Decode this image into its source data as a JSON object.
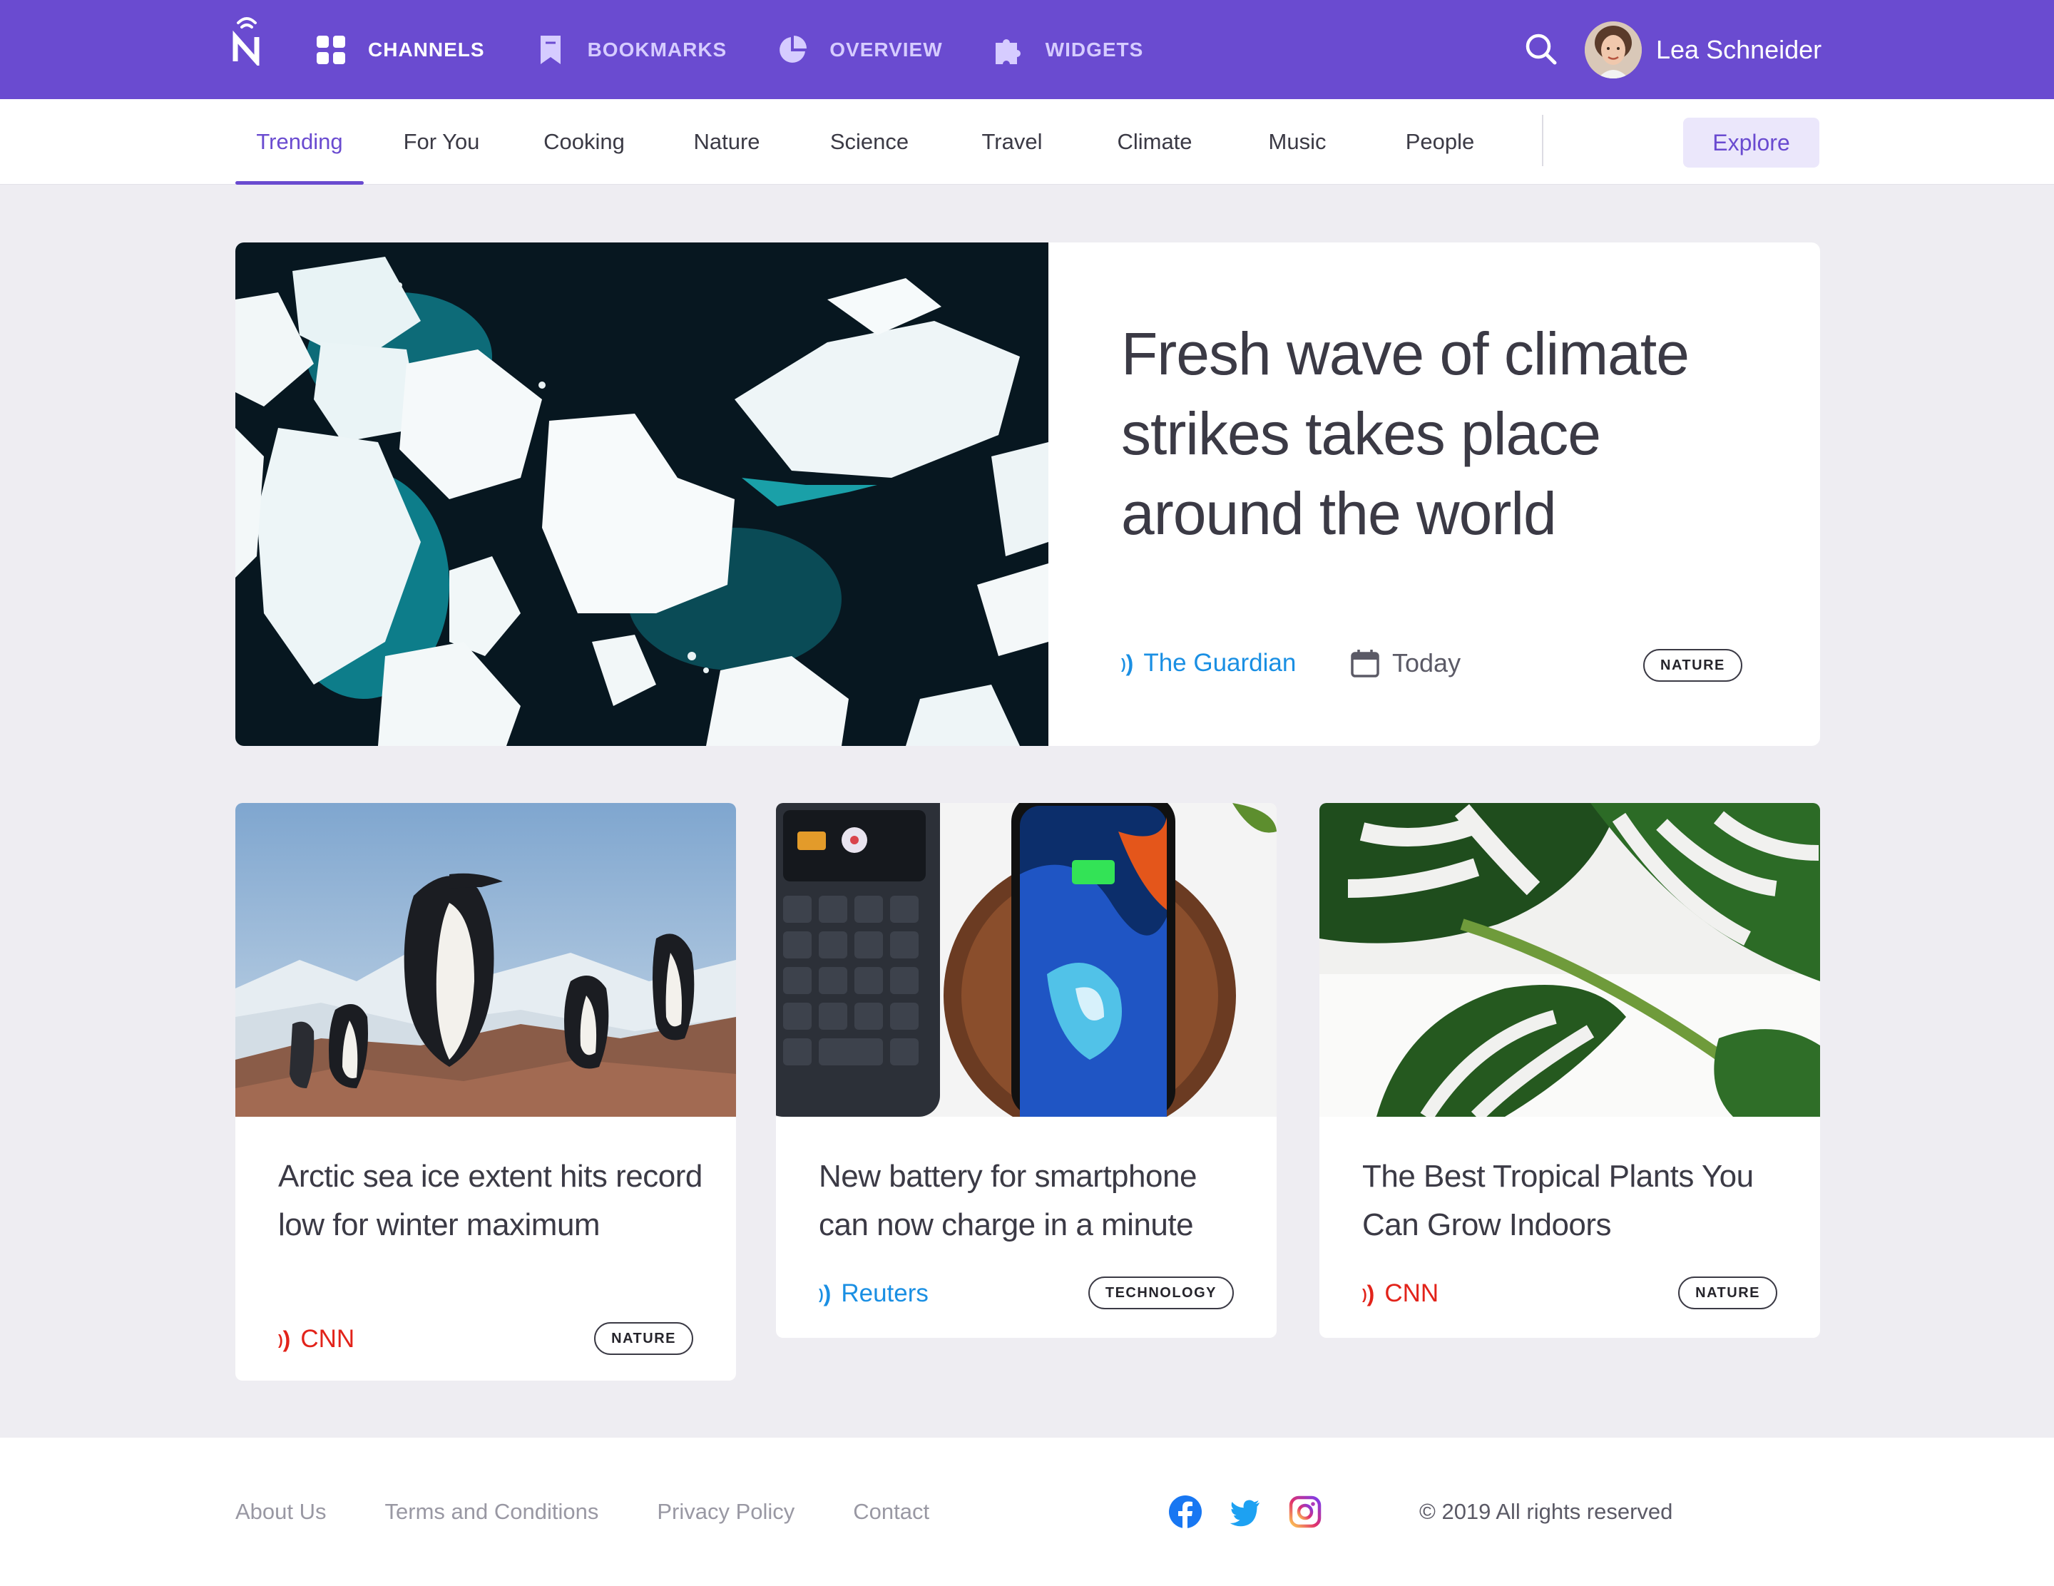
{
  "header": {
    "nav": [
      {
        "label": "CHANNELS",
        "icon": "grid-icon",
        "active": true
      },
      {
        "label": "BOOKMARKS",
        "icon": "bookmark-icon",
        "active": false
      },
      {
        "label": "OVERVIEW",
        "icon": "pie-chart-icon",
        "active": false
      },
      {
        "label": "WIDGETS",
        "icon": "puzzle-icon",
        "active": false
      }
    ],
    "user": {
      "name": "Lea Schneider"
    }
  },
  "tabs": {
    "items": [
      {
        "label": "Trending",
        "active": true
      },
      {
        "label": "For You"
      },
      {
        "label": "Cooking"
      },
      {
        "label": "Nature"
      },
      {
        "label": "Science"
      },
      {
        "label": "Travel"
      },
      {
        "label": "Climate"
      },
      {
        "label": "Music"
      },
      {
        "label": "People"
      }
    ],
    "explore_label": "Explore"
  },
  "hero": {
    "title": "Fresh wave of climate strikes takes place around the world",
    "source": "The Guardian",
    "source_color": "#1a8fe3",
    "date": "Today",
    "tag": "NATURE"
  },
  "cards": [
    {
      "title": "Arctic sea ice extent hits record low for winter maximum",
      "source": "CNN",
      "source_color": "#e2231a",
      "tag": "NATURE"
    },
    {
      "title": "New battery for smartphone can now charge in a minute",
      "source": "Reuters",
      "source_color": "#1a8fe3",
      "tag": "TECHNOLOGY"
    },
    {
      "title": "The Best Tropical Plants You Can Grow Indoors",
      "source": "CNN",
      "source_color": "#e2231a",
      "tag": "NATURE"
    }
  ],
  "footer": {
    "links": [
      "About Us",
      "Terms and Conditions",
      "Privacy Policy",
      "Contact"
    ],
    "social": [
      "facebook-icon",
      "twitter-icon",
      "instagram-icon"
    ],
    "copyright": "© 2019 All rights reserved"
  },
  "colors": {
    "accent": "#6a4bd0",
    "background": "#eeedf2"
  }
}
